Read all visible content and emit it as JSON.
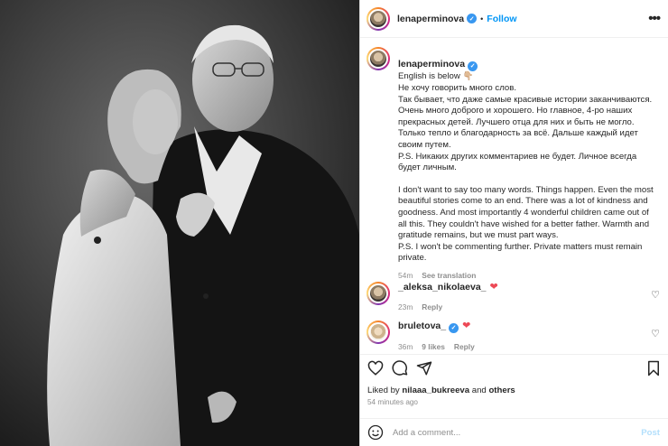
{
  "post": {
    "username": "lenaperminova",
    "follow_label": "Follow",
    "dot": "•",
    "more_label": "•••"
  },
  "caption": {
    "username": "lenaperminova",
    "first_line": "English is below 👇🏼",
    "ru_text": "Не хочу говорить много слов.\nТак бывает, что даже самые красивые истории заканчиваются. Очень много доброго и хорошего. Но главное, 4-ро наших прекрасных детей. Лучшего отца для них и быть не могло. Только тепло и благодарность за всё. Дальше каждый идет своим путем.\nP.S. Никаких других комментариев не будет. Личное всегда будет личным.",
    "en_text": "I don't want to say too many words. Things happen. Even the most beautiful stories come to an end. There was a lot of kindness and goodness. And most importantly 4 wonderful children came out of all this. They couldn't have wished for a better father. Warmth and gratitude remains, but we must part ways.\nP.S. I won't be commenting further. Private matters must remain private.",
    "time": "54m",
    "see_translation": "See translation"
  },
  "comments": [
    {
      "username": "_aleksa_nikolaeva_",
      "heart": "❤",
      "time": "23m",
      "reply": "Reply"
    },
    {
      "username": "bruletova_",
      "heart": "❤",
      "time": "36m",
      "likes": "9 likes",
      "reply": "Reply"
    }
  ],
  "likes": {
    "prefix": "Liked by",
    "user": "nilaaa_bukreeva",
    "and": "and",
    "others": "others"
  },
  "posted_time": "54 minutes ago",
  "add_comment": {
    "placeholder": "Add a comment...",
    "post_label": "Post"
  },
  "icons": {
    "like": "heart-icon",
    "comment": "comment-icon",
    "share": "share-icon",
    "save": "bookmark-icon",
    "emoji": "emoji-icon"
  },
  "colors": {
    "accent": "#0095f6",
    "verified": "#3897f0",
    "red_heart": "#ed4956"
  }
}
